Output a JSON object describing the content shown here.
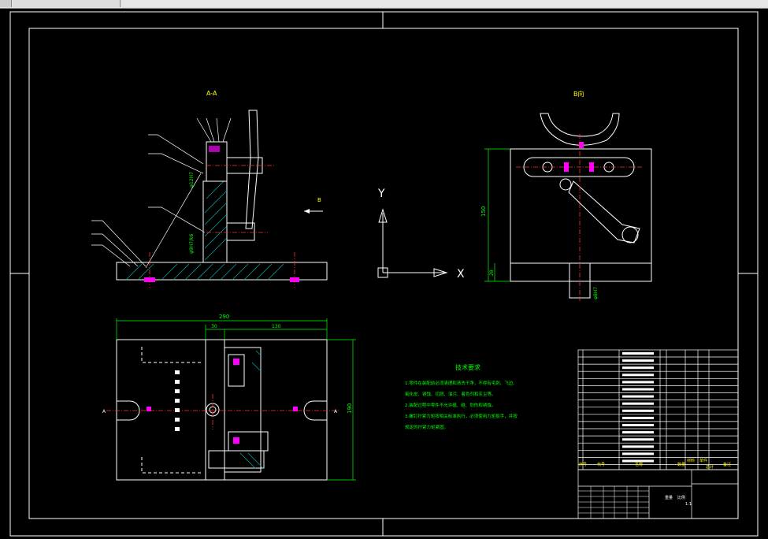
{
  "window": {
    "title": ""
  },
  "drawing": {
    "section_label": "A-A",
    "view_label": "B向",
    "section_mark_a": "A",
    "direction_mark_b": "B",
    "ucs_x": "X",
    "ucs_y": "Y",
    "dims": {
      "overall_length": "290",
      "length_30": "30",
      "length_130": "130",
      "width_190": "190",
      "height_150": "150",
      "height_28": "28"
    },
    "leader_numbers": [
      "1",
      "2",
      "3",
      "4",
      "5",
      "6",
      "7",
      "8",
      "9",
      "10",
      "11",
      "12"
    ],
    "notes": {
      "title": "技术要求",
      "lines": [
        "1.零件在装配前必须清理和清洗干净，不得有毛刺、飞边、",
        "氧化皮、锈蚀、切屑、油污、着色剂和灰尘等。",
        "2.装配过程中零件不允许磕、碰、划伤和锈蚀。",
        "3.螺钉拧紧力矩按相关标准执行，必须使用力矩扳手，并按",
        "规定的拧紧力矩紧固。"
      ]
    },
    "bom_headers": [
      "序号",
      "代号",
      "名称",
      "数量",
      "材料",
      "单件",
      "总计",
      "备注"
    ],
    "title_block": {
      "weight_label": "重量",
      "scale_label": "比例",
      "scale": "1:1"
    }
  },
  "colors": {
    "background": "#000000",
    "frame": "#ffffff",
    "dimension": "#00ff00",
    "hatch": "#00a0a0",
    "center": "#ff3030",
    "highlight": "#ff00ff",
    "label": "#ffff00"
  }
}
